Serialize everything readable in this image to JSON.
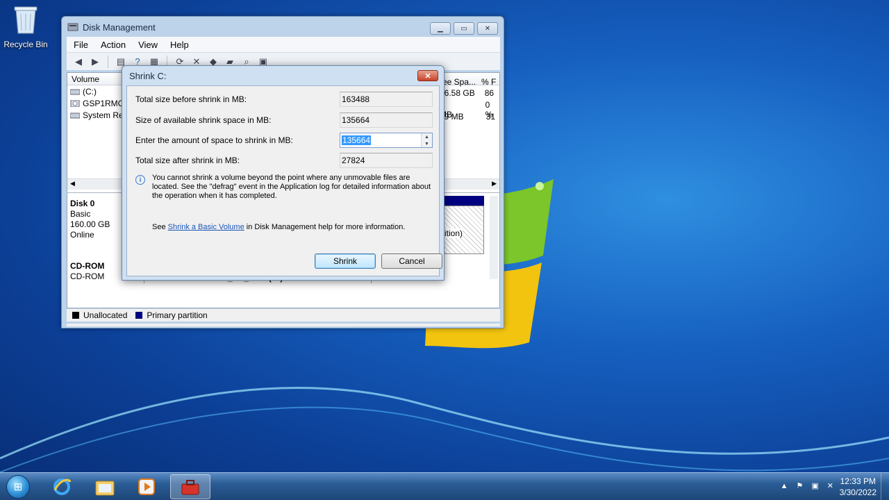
{
  "desktop": {
    "recycle_bin_label": "Recycle Bin"
  },
  "window": {
    "title": "Disk Management",
    "menu": [
      "File",
      "Action",
      "View",
      "Help"
    ],
    "volume_header": "Volume",
    "free_space_header": "ree Spa...",
    "pct_free_header": "% F",
    "volumes": [
      {
        "name": "(C:)",
        "free": "36.58 GB",
        "pct": "86"
      },
      {
        "name": "GSP1RMCUL",
        "free": "0 MB",
        "pct": "0 %"
      },
      {
        "name": "System Res",
        "free": "09 MB",
        "pct": "31"
      }
    ],
    "disk0": {
      "name": "Disk 0",
      "type": "Basic",
      "size": "160.00 GB",
      "status": "Online",
      "partition_tail": "ition)"
    },
    "cdrom": {
      "name": "CD-ROM",
      "type": "CD-ROM",
      "volume": "GSP1RMCULXFRER_EN_DVD  (D:)"
    },
    "legend": {
      "unallocated": "Unallocated",
      "primary": "Primary partition"
    }
  },
  "dialog": {
    "title": "Shrink C:",
    "total_before_label": "Total size before shrink in MB:",
    "total_before_value": "163488",
    "available_label": "Size of available shrink space in MB:",
    "available_value": "135664",
    "amount_label": "Enter the amount of space to shrink in MB:",
    "amount_value": "135664",
    "total_after_label": "Total size after shrink in MB:",
    "total_after_value": "27824",
    "info_text": "You cannot shrink a volume beyond the point where any unmovable files are located. See the \"defrag\" event in the Application log for detailed information about the operation when it has completed.",
    "help_prefix": "See ",
    "help_link": "Shrink a Basic Volume",
    "help_suffix": " in Disk Management help for more information.",
    "shrink_button": "Shrink",
    "cancel_button": "Cancel"
  },
  "taskbar": {
    "time": "12:33 PM",
    "date": "3/30/2022"
  },
  "colors": {
    "unallocated": "#000000",
    "primary_partition": "#000080",
    "selection": "#3399ff"
  }
}
